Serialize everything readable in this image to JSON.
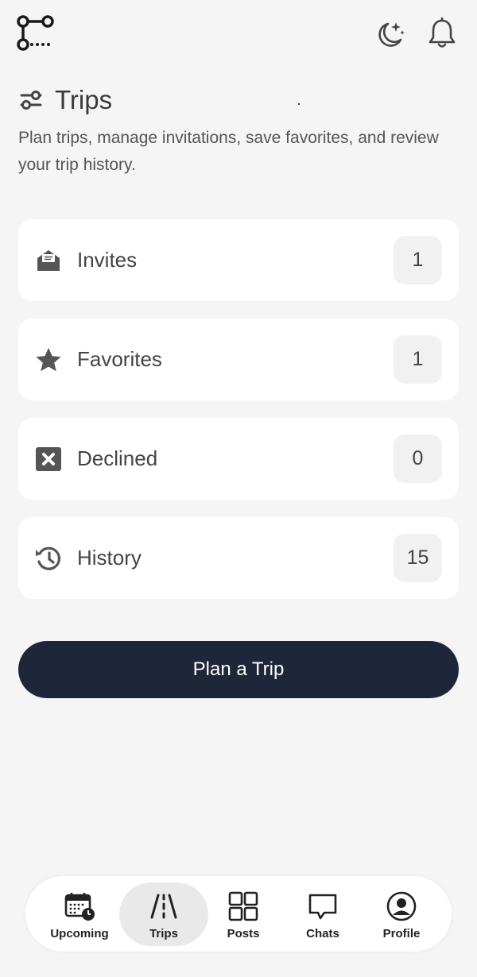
{
  "header": {
    "logo_icon": "route-icon",
    "theme_icon": "moon-stars-icon",
    "notification_icon": "bell-icon"
  },
  "page": {
    "title_icon": "sliders-icon",
    "title": "Trips",
    "subtitle": "Plan trips, manage invitations, save favorites, and review your trip history."
  },
  "cards": [
    {
      "icon": "envelope-icon",
      "label": "Invites",
      "count": "1"
    },
    {
      "icon": "star-icon",
      "label": "Favorites",
      "count": "1"
    },
    {
      "icon": "x-square-icon",
      "label": "Declined",
      "count": "0"
    },
    {
      "icon": "history-icon",
      "label": "History",
      "count": "15"
    }
  ],
  "plan_button": {
    "label": "Plan a Trip"
  },
  "nav": [
    {
      "icon": "calendar-clock-icon",
      "label": "Upcoming",
      "active": false
    },
    {
      "icon": "road-icon",
      "label": "Trips",
      "active": true
    },
    {
      "icon": "grid-icon",
      "label": "Posts",
      "active": false
    },
    {
      "icon": "chat-bubble-icon",
      "label": "Chats",
      "active": false
    },
    {
      "icon": "user-circle-icon",
      "label": "Profile",
      "active": false
    }
  ],
  "colors": {
    "background": "#f5f5f5",
    "card": "#ffffff",
    "badge": "#f1f1f1",
    "primary_button": "#1e2739",
    "nav_active": "#e9e9e9",
    "icon": "#444444"
  }
}
